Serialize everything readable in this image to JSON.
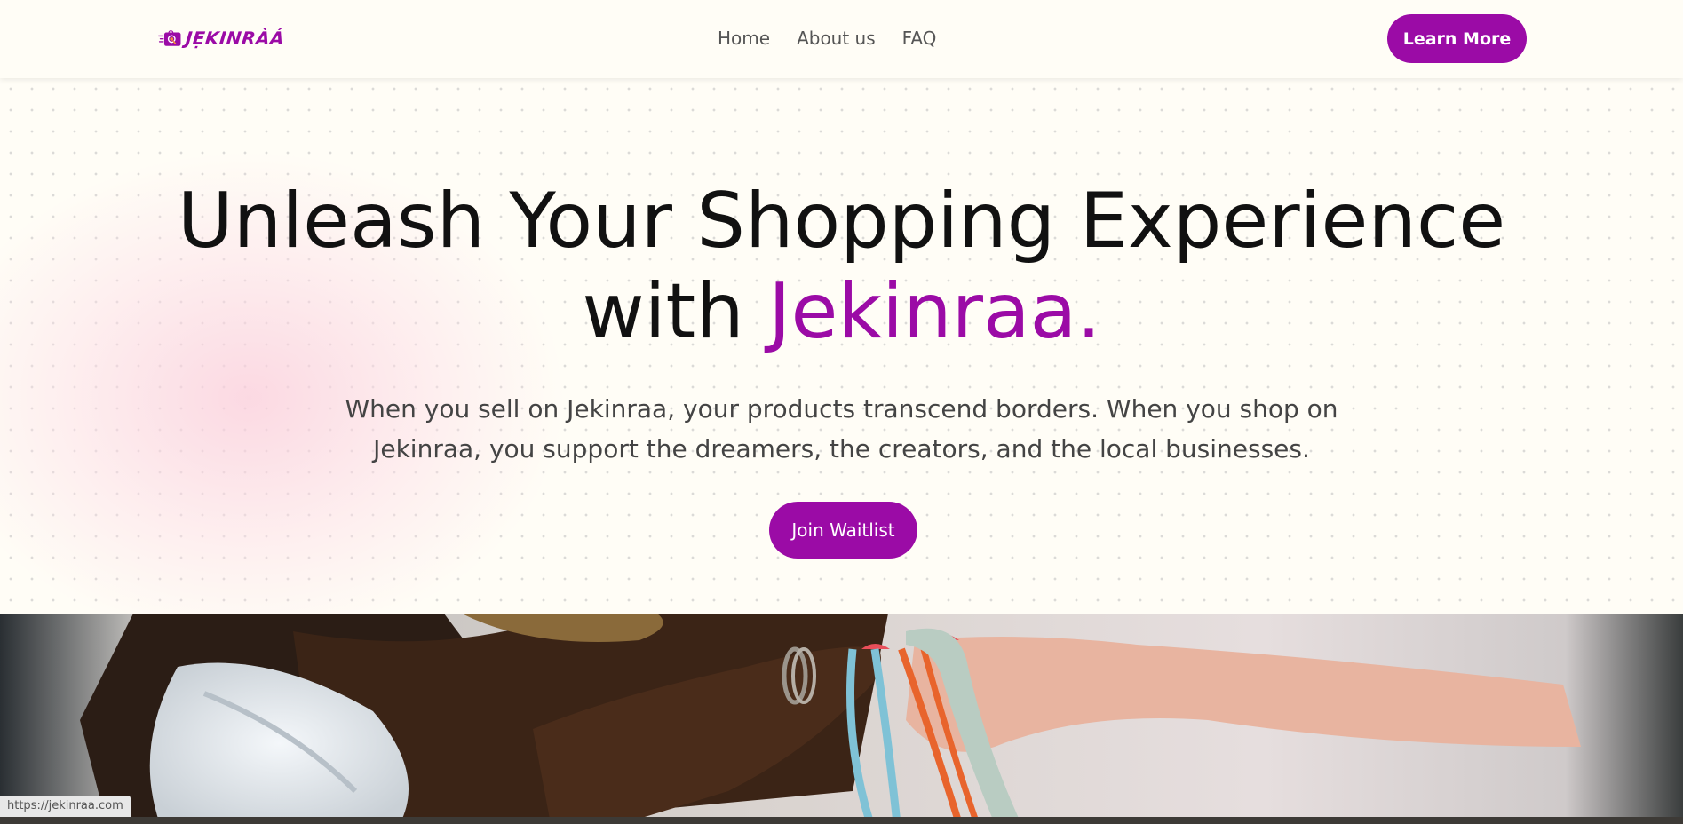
{
  "brand": {
    "name": "JẸKINRÀÁ",
    "primary_color": "#9b0ba6"
  },
  "nav": {
    "links": [
      "Home",
      "About us",
      "FAQ"
    ],
    "cta_label": "Learn More"
  },
  "hero": {
    "title_line1": "Unleash Your Shopping Experience",
    "title_with": "with ",
    "title_accent": "Jekinraa.",
    "subtitle": "When you sell on Jekinraa, your products transcend borders. When you shop on Jekinraa, you support the dreamers, the creators, and the local businesses.",
    "button_label": "Join Waitlist"
  },
  "status_bar": {
    "url": "https://jekinraa.com"
  }
}
